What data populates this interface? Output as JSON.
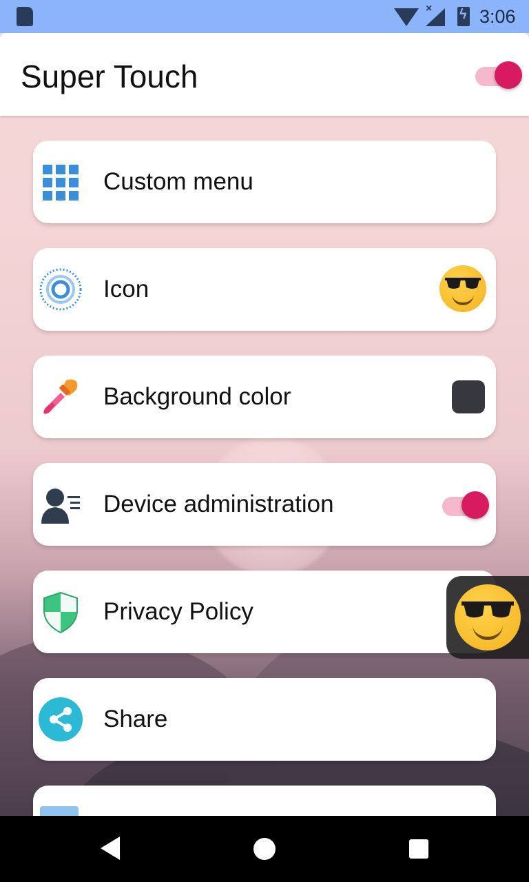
{
  "status_bar": {
    "time": "3:06",
    "icons": [
      "sd-card-icon",
      "wifi-icon",
      "signal-icon",
      "battery-charging-icon"
    ]
  },
  "app_bar": {
    "title": "Super Touch",
    "master_toggle_on": true
  },
  "settings": [
    {
      "id": "custom-menu",
      "label": "Custom menu",
      "icon": "grid-icon"
    },
    {
      "id": "icon",
      "label": "Icon",
      "icon": "target-icon",
      "trailing": "sunglasses-emoji-icon"
    },
    {
      "id": "background-color",
      "label": "Background color",
      "icon": "eyedropper-icon",
      "trailing_color": "#37383f"
    },
    {
      "id": "device-administration",
      "label": "Device administration",
      "icon": "admin-user-icon",
      "toggle_on": true
    },
    {
      "id": "privacy-policy",
      "label": "Privacy Policy",
      "icon": "shield-icon"
    },
    {
      "id": "share",
      "label": "Share",
      "icon": "share-icon"
    }
  ],
  "colors": {
    "accent": "#d81b60",
    "status_bar": "#8cb4fb",
    "grid_icon": "#3a8fd8",
    "share_icon": "#2cb9d6",
    "shield_icon": "#3dc47e"
  }
}
